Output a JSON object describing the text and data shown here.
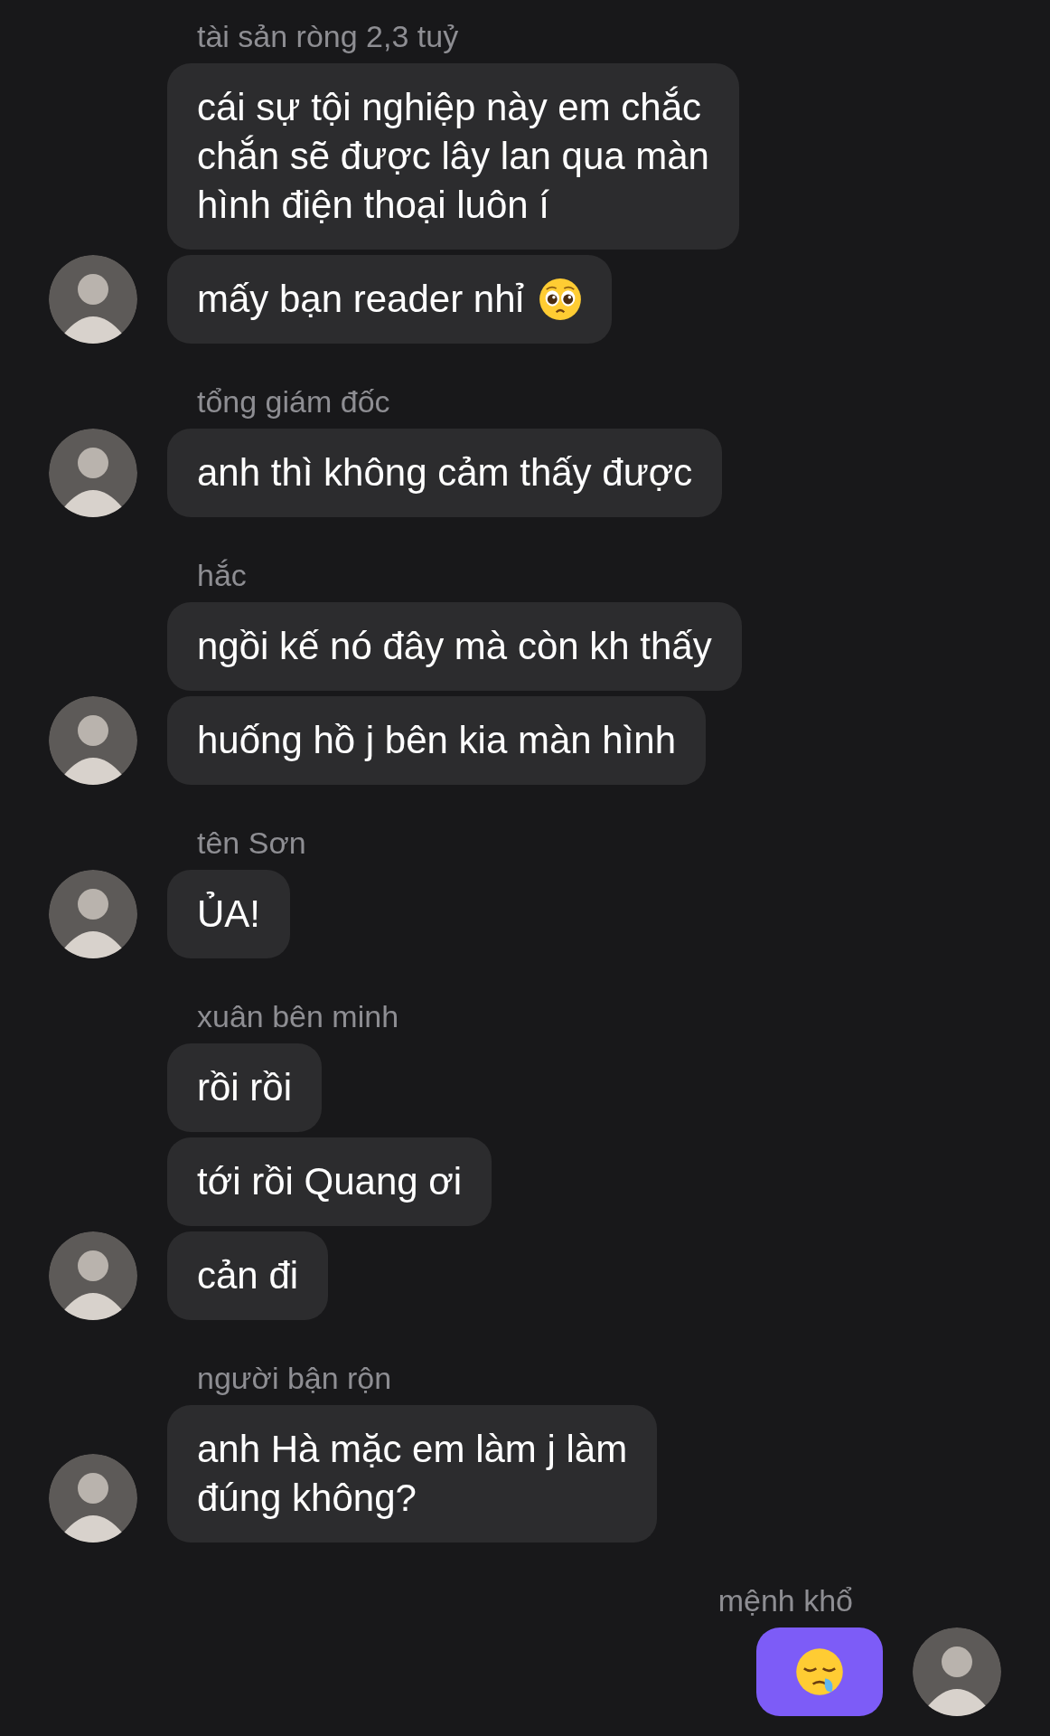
{
  "groups": [
    {
      "sender": "tài sản ròng 2,3 tuỷ",
      "outgoing": false,
      "messages": [
        {
          "lines": [
            "cái sự tội nghiệp này em chắc",
            "chắn sẽ được lây lan qua màn",
            "hình điện thoại luôn í"
          ]
        },
        {
          "lines": [
            "mấy bạn reader nhỉ"
          ],
          "kind": "pleading"
        }
      ]
    },
    {
      "sender": "tổng giám đốc",
      "outgoing": false,
      "messages": [
        {
          "lines": [
            "anh thì không cảm thấy được"
          ]
        }
      ]
    },
    {
      "sender": "hắc",
      "outgoing": false,
      "messages": [
        {
          "lines": [
            "ngồi kế nó đây mà còn kh thấy"
          ]
        },
        {
          "lines": [
            "huống hồ j bên kia màn hình"
          ]
        }
      ]
    },
    {
      "sender": "tên Sơn",
      "outgoing": false,
      "messages": [
        {
          "lines": [
            "ỦA!"
          ]
        }
      ]
    },
    {
      "sender": "xuân bên minh",
      "outgoing": false,
      "messages": [
        {
          "lines": [
            "rồi rồi"
          ]
        },
        {
          "lines": [
            "tới rồi Quang ơi"
          ]
        },
        {
          "lines": [
            "cản đi"
          ]
        }
      ]
    },
    {
      "sender": "người bận rộn",
      "outgoing": false,
      "messages": [
        {
          "lines": [
            "anh Hà mặc em làm j làm",
            "đúng không?"
          ]
        }
      ]
    },
    {
      "sender": "mệnh khổ",
      "outgoing": true,
      "messages": [
        {
          "kind": "sleepy"
        }
      ]
    }
  ]
}
